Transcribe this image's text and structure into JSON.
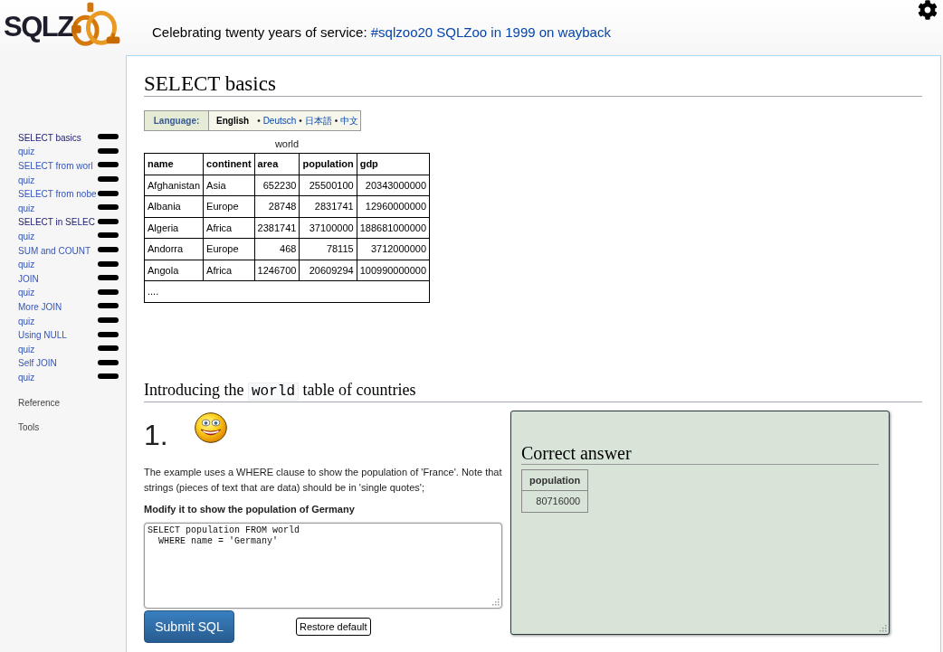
{
  "header": {
    "logo_text": "SQLZ",
    "banner_text": "Celebrating twenty years of service:",
    "banner_links": [
      "#sqlzoo20",
      "SQLZoo in 1999 on wayback"
    ]
  },
  "sidebar": {
    "items": [
      {
        "label": "SELECT basics",
        "visited": true
      },
      {
        "label": "quiz",
        "visited": false
      },
      {
        "label": "SELECT from worl",
        "visited": false
      },
      {
        "label": "quiz",
        "visited": false
      },
      {
        "label": "SELECT from nobe",
        "visited": false
      },
      {
        "label": "quiz",
        "visited": false
      },
      {
        "label": "SELECT in SELEC",
        "visited": true
      },
      {
        "label": "quiz",
        "visited": false
      },
      {
        "label": "SUM and COUNT",
        "visited": false
      },
      {
        "label": "quiz",
        "visited": false
      },
      {
        "label": "JOIN",
        "visited": false
      },
      {
        "label": "quiz",
        "visited": false
      },
      {
        "label": "More JOIN",
        "visited": false
      },
      {
        "label": "quiz",
        "visited": false
      },
      {
        "label": "Using NULL",
        "visited": false
      },
      {
        "label": "quiz",
        "visited": false
      },
      {
        "label": "Self JOIN",
        "visited": false
      },
      {
        "label": "quiz",
        "visited": false
      }
    ],
    "footer_links": [
      "Reference",
      "Tools"
    ]
  },
  "content": {
    "title": "SELECT basics",
    "language": {
      "label": "Language:",
      "options": [
        {
          "label": "English",
          "selected": true
        },
        {
          "bullet": "•",
          "label": "Deutsch",
          "selected": false
        },
        {
          "bullet": "•",
          "label": "日本語",
          "selected": false
        },
        {
          "bullet": "•",
          "label": "中文",
          "selected": false
        }
      ]
    },
    "table": {
      "caption": "world",
      "columns": [
        {
          "label": "name",
          "numeric": false
        },
        {
          "label": "continent",
          "numeric": false
        },
        {
          "label": "area",
          "numeric": true
        },
        {
          "label": "population",
          "numeric": true
        },
        {
          "label": "gdp",
          "numeric": true
        }
      ],
      "rows": [
        [
          "Afghanistan",
          "Asia",
          "652230",
          "25500100",
          "20343000000"
        ],
        [
          "Albania",
          "Europe",
          "28748",
          "2831741",
          "12960000000"
        ],
        [
          "Algeria",
          "Africa",
          "2381741",
          "37100000",
          "188681000000"
        ],
        [
          "Andorra",
          "Europe",
          "468",
          "78115",
          "3712000000"
        ],
        [
          "Angola",
          "Africa",
          "1246700",
          "20609294",
          "100990000000"
        ]
      ],
      "more": "...."
    },
    "section_heading": {
      "before": "Introducing the",
      "code": "world",
      "after": "table of countries"
    },
    "exercise": {
      "number": "1.",
      "description": "The example uses a WHERE clause to show the population of 'France'. Note that strings (pieces of text that are data) should be in 'single quotes';",
      "task": "Modify it to show the population of Germany",
      "sql": "SELECT population FROM world\n  WHERE name = 'Germany'",
      "buttons": [
        {
          "label": "Submit SQL",
          "kind": "primary"
        },
        {
          "label": "Restore default",
          "kind": "secondary"
        }
      ]
    },
    "answer": {
      "title": "Correct answer",
      "columns": [
        {
          "label": "population",
          "numeric": true
        }
      ],
      "rows": [
        [
          "80716000"
        ]
      ]
    }
  }
}
